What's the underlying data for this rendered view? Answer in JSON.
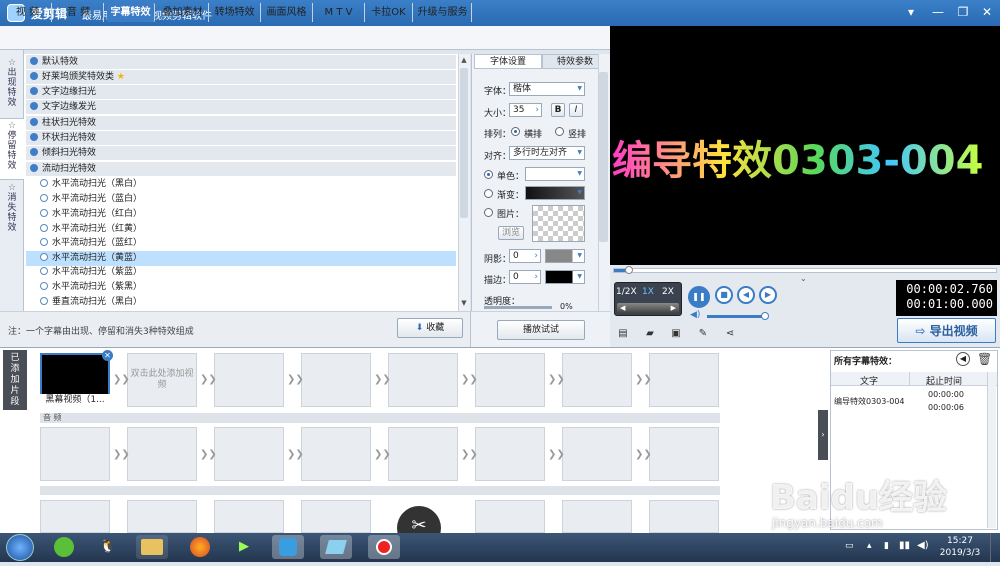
{
  "window": {
    "title": "爱剪辑",
    "slogan": "最易用、强大的视频剪辑软件"
  },
  "menu": {
    "tabs": [
      "视 频",
      "音 频",
      "字幕特效",
      "叠加素材",
      "转场特效",
      "画面风格",
      "M T V",
      "卡拉OK",
      "升级与服务"
    ]
  },
  "side_tabs": [
    "出现特效",
    "停留特效",
    "消失特效"
  ],
  "effects": {
    "categories": [
      "默认特效",
      "好莱坞颁奖特效类",
      "文字边缘扫光",
      "文字边缘发光",
      "柱状扫光特效",
      "环状扫光特效",
      "倾斜扫光特效",
      "流动扫光特效"
    ],
    "items": [
      "水平流动扫光（黑白）",
      "水平流动扫光（蓝白）",
      "水平流动扫光（红白）",
      "水平流动扫光（红黄）",
      "水平流动扫光（蓝红）",
      "水平流动扫光（黄蓝）",
      "水平流动扫光（紫蓝）",
      "水平流动扫光（紫黑）",
      "垂直流动扫光（黑白）"
    ],
    "selected": "水平流动扫光（黄蓝）"
  },
  "list_footer": {
    "note": "注：一个字幕由出现、停留和消失3种特效组成",
    "collect_button": "收藏",
    "play_button": "播放试试"
  },
  "font_panel": {
    "tabs": [
      "字体设置",
      "特效参数"
    ],
    "font_label": "字体：",
    "font_value": "楷体",
    "size_label": "大小：",
    "size_value": "35",
    "bold": "B",
    "italic": "I",
    "arrange_label": "排列：",
    "arrange_horizontal": "横排",
    "arrange_vertical": "竖排",
    "align_label": "对齐：",
    "align_value": "多行时左对齐",
    "solid_color": "单色：",
    "gradient": "渐变：",
    "image": "图片：",
    "browse": "浏览",
    "shadow_label": "阴影：",
    "shadow_value": "0",
    "stroke_label": "描边：",
    "stroke_value": "0",
    "opacity_label": "透明度：",
    "opacity_value": "0%"
  },
  "preview": {
    "subtitle_text": "编导特效0303-004",
    "progress_fraction": 0.04
  },
  "playback": {
    "speeds": [
      "1/2X",
      "1X",
      "2X"
    ],
    "current_time": "00:00:02.760",
    "total_time": "00:01:00.000",
    "export_button": "导出视频"
  },
  "timeline": {
    "added_label": "已添加片段",
    "clip_label": "黑幕视频（1...",
    "empty_slot_text": "双击此处添加视频",
    "audio_label": "音 频"
  },
  "subtitle_panel": {
    "title": "所有字幕特效：",
    "col_text": "文字",
    "col_time": "起止时间",
    "rows": [
      {
        "text": "编导特效0303-004",
        "start": "00:00:00",
        "end": "00:00:06"
      }
    ]
  },
  "taskbar": {
    "time": "15:27",
    "date": "2019/3/3"
  },
  "watermark": {
    "brand": "Baidu经验",
    "url": "jingyan.baidu.com"
  }
}
